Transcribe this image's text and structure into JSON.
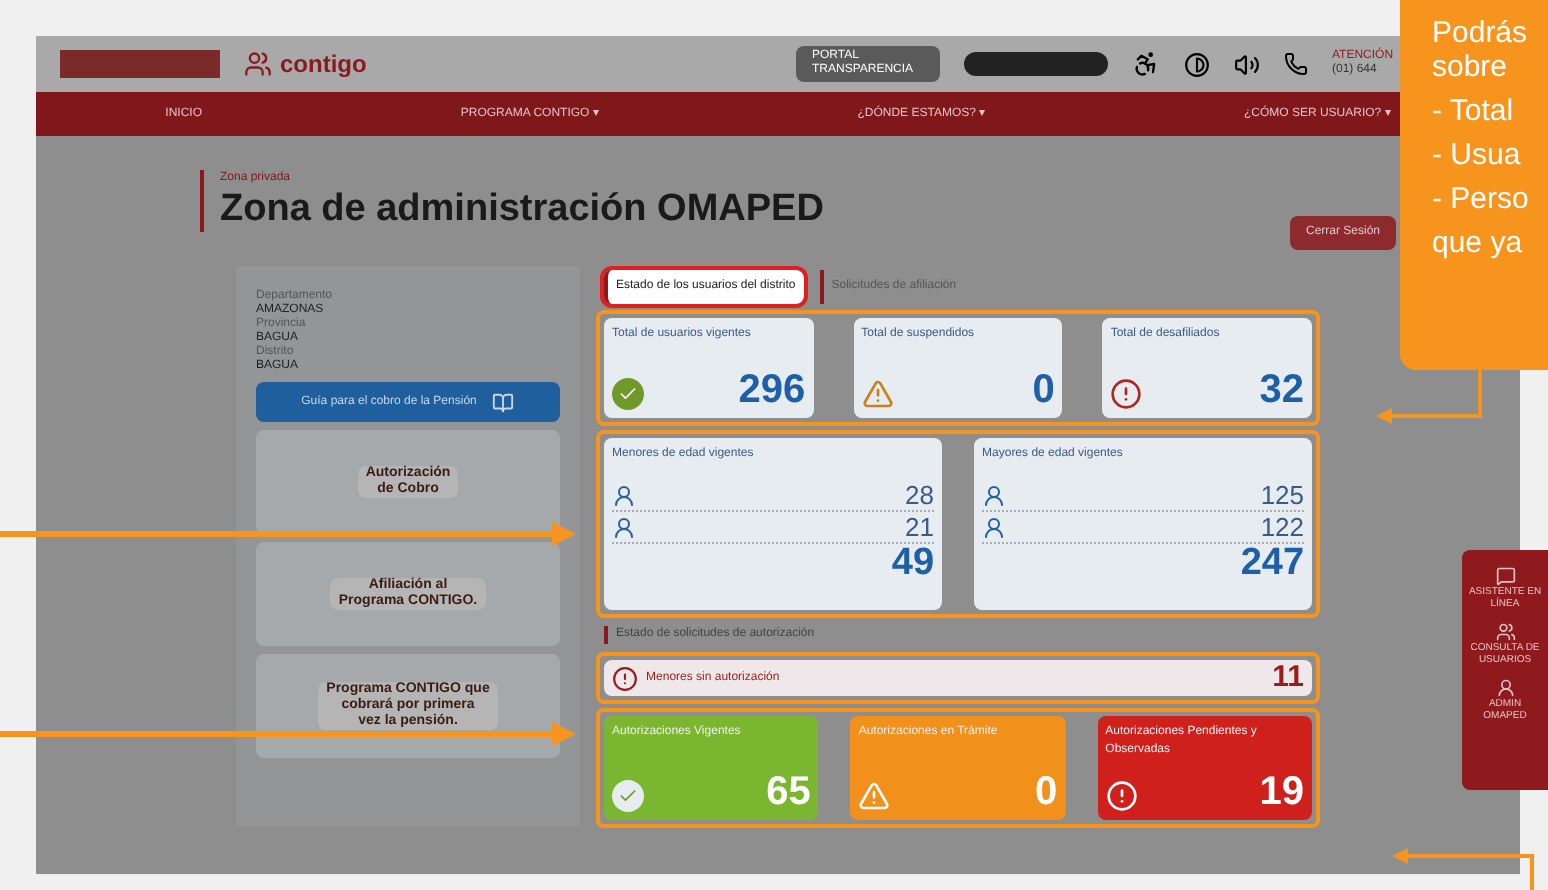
{
  "header": {
    "brand": "contigo",
    "transparency": "PORTAL TRANSPARENCIA",
    "contact_label": "ATENCIÓN",
    "contact_phone": "(01) 644"
  },
  "nav": [
    {
      "label": "INICIO"
    },
    {
      "label": "PROGRAMA CONTIGO ▾"
    },
    {
      "label": "¿DÓNDE ESTAMOS? ▾"
    },
    {
      "label": "¿CÓMO SER USUARIO? ▾"
    }
  ],
  "page": {
    "kicker": "Zona privada",
    "title": "Zona de administración OMAPED",
    "logout": "Cerrar Sesión"
  },
  "location": [
    {
      "label": "Departamento",
      "value": "AMAZONAS"
    },
    {
      "label": "Provincia",
      "value": "BAGUA"
    },
    {
      "label": "Distrito",
      "value": "BAGUA"
    }
  ],
  "guide_button": "Guía para el cobro de la Pensión",
  "banners": [
    {
      "lines": [
        "Autorización",
        "de Cobro"
      ]
    },
    {
      "lines": [
        "Afiliación al",
        "Programa CONTIGO."
      ]
    },
    {
      "lines": [
        "Programa CONTIGO que",
        "cobrará por primera",
        "vez la pensión."
      ]
    }
  ],
  "tabs": [
    {
      "label": "Estado de los usuarios del distrito",
      "selected": true
    },
    {
      "label": "Solicitudes de afiliación",
      "selected": false
    }
  ],
  "totals": [
    {
      "label": "Total de usuarios vigentes",
      "value": "296",
      "kind": "ok"
    },
    {
      "label": "Total de suspendidos",
      "value": "0",
      "kind": "warning"
    },
    {
      "label": "Total de desafiliados",
      "value": "32",
      "kind": "error"
    }
  ],
  "age_groups": [
    {
      "label": "Menores de edad vigentes",
      "rows": [
        "28",
        "21"
      ],
      "total": "49"
    },
    {
      "label": "Mayores de edad vigentes",
      "rows": [
        "125",
        "122"
      ],
      "total": "247"
    }
  ],
  "authorization_section": "Estado de solicitudes de autorización",
  "unauthorized": {
    "label": "Menores sin autorización",
    "value": "11"
  },
  "authorizations": [
    {
      "label": "Autorizaciones Vigentes",
      "value": "65",
      "kind": "ok",
      "color": "#7ab62f"
    },
    {
      "label": "Autorizaciones en Trámite",
      "value": "0",
      "kind": "warning",
      "color": "#f2901c"
    },
    {
      "label": "Autorizaciones Pendientes y Observadas",
      "value": "19",
      "kind": "error",
      "color": "#d0201c"
    }
  ],
  "side_menu": [
    {
      "label": "ASISTENTE EN LÍNEA"
    },
    {
      "label": "CONSULTA DE USUARIOS"
    },
    {
      "label": "ADMIN OMAPED"
    }
  ],
  "callout": {
    "lines": [
      "Podrás",
      "sobre",
      "- Total",
      "- Usua",
      "-  Perso",
      "que ya"
    ]
  }
}
